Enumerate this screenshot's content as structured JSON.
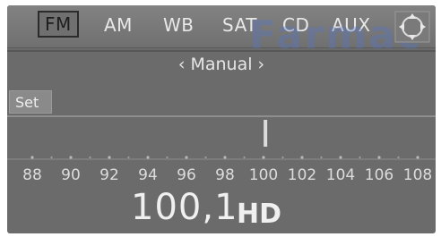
{
  "sources": [
    {
      "label": "FM",
      "selected": true
    },
    {
      "label": "AM",
      "selected": false
    },
    {
      "label": "WB",
      "selected": false
    },
    {
      "label": "SAT",
      "selected": false
    },
    {
      "label": "CD",
      "selected": false
    },
    {
      "label": "AUX",
      "selected": false
    }
  ],
  "watermark": "Farmac",
  "mode": {
    "label": "‹ Manual ›"
  },
  "set_button": "Set",
  "tuner": {
    "ticks": [
      "88",
      "90",
      "92",
      "94",
      "96",
      "98",
      "100",
      "102",
      "104",
      "106",
      "108"
    ],
    "min": 88,
    "max": 108,
    "current": 100.1
  },
  "frequency": {
    "value": "100,1",
    "hd_logo": "HD"
  },
  "colors": {
    "background": "#6b6b6b",
    "text": "#e8e8e8",
    "selected_border": "#2b2b2b"
  }
}
